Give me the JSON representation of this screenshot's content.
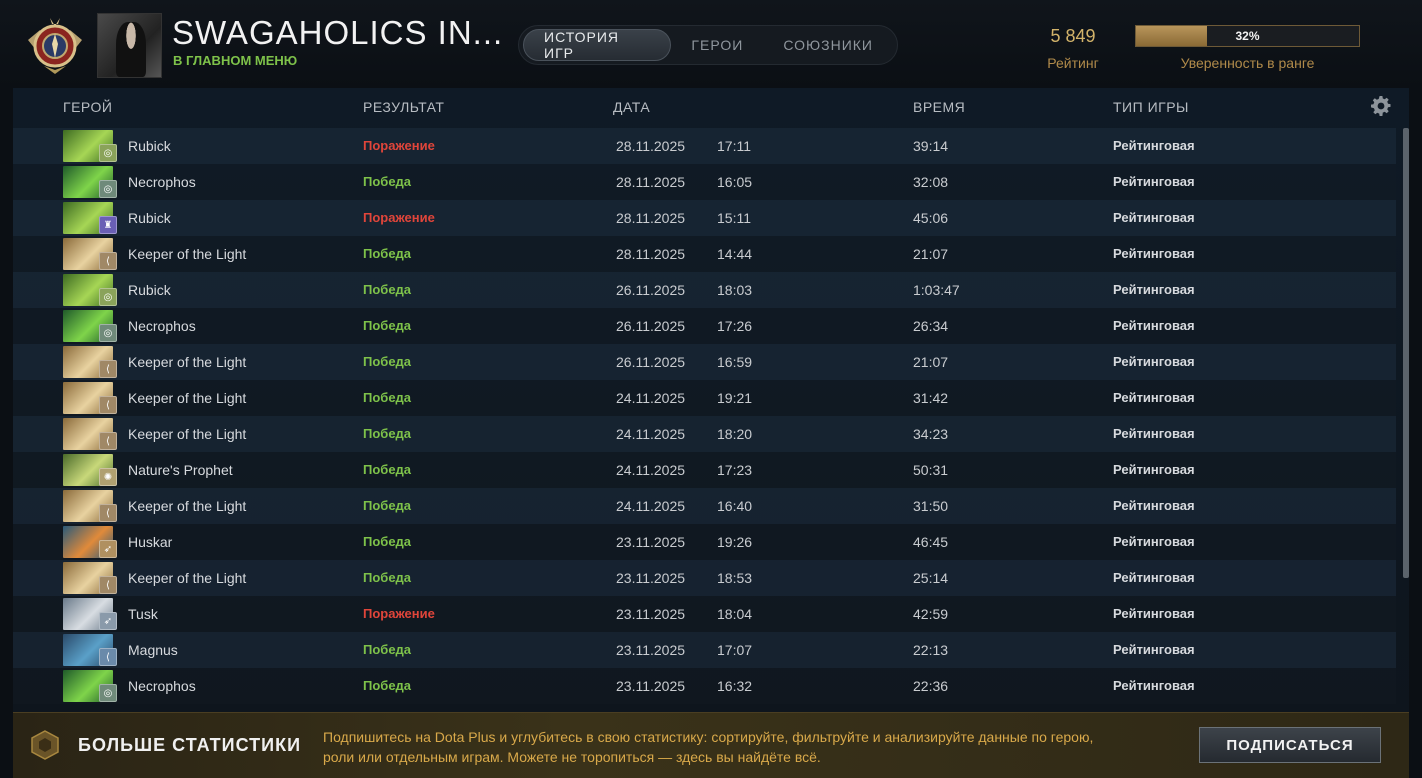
{
  "header": {
    "player_name": "SWAGAHOLICS IN...",
    "status": "В ГЛАВНОМ МЕНЮ",
    "tabs": [
      {
        "label": "ИСТОРИЯ ИГР",
        "active": true
      },
      {
        "label": "ГЕРОИ",
        "active": false
      },
      {
        "label": "СОЮЗНИКИ",
        "active": false
      }
    ],
    "rating_value": "5 849",
    "rating_label": "Рейтинг",
    "confidence_percent": 32,
    "confidence_text": "32%",
    "confidence_label": "Уверенность в ранге"
  },
  "table": {
    "columns": {
      "hero": "ГЕРОЙ",
      "result": "РЕЗУЛЬТАТ",
      "date": "ДАТА",
      "duration": "ВРЕМЯ",
      "game_type": "ТИП ИГРЫ"
    },
    "rows": [
      {
        "hero": "Rubick",
        "result": "Поражение",
        "outcome": "loss",
        "date": "28.11.2025",
        "time": "17:11",
        "duration": "39:14",
        "type": "Рейтинговая",
        "hero_colors": [
          "#3d6b22",
          "#a6d655"
        ],
        "role_color": "#8aa35a",
        "role_icon": "circle-icon"
      },
      {
        "hero": "Necrophos",
        "result": "Победа",
        "outcome": "win",
        "date": "28.11.2025",
        "time": "16:05",
        "duration": "32:08",
        "type": "Рейтинговая",
        "hero_colors": [
          "#1f5a2a",
          "#7fd44a"
        ],
        "role_color": "#6f8a7a",
        "role_icon": "circle-icon"
      },
      {
        "hero": "Rubick",
        "result": "Поражение",
        "outcome": "loss",
        "date": "28.11.2025",
        "time": "15:11",
        "duration": "45:06",
        "type": "Рейтинговая",
        "hero_colors": [
          "#3d6b22",
          "#a6d655"
        ],
        "role_color": "#6a5fb5",
        "role_icon": "chess-icon"
      },
      {
        "hero": "Keeper of the Light",
        "result": "Победа",
        "outcome": "win",
        "date": "28.11.2025",
        "time": "14:44",
        "duration": "21:07",
        "type": "Рейтинговая",
        "hero_colors": [
          "#8a6a3a",
          "#e8d2a0"
        ],
        "role_color": "#a08866",
        "role_icon": "wing-icon"
      },
      {
        "hero": "Rubick",
        "result": "Победа",
        "outcome": "win",
        "date": "26.11.2025",
        "time": "18:03",
        "duration": "1:03:47",
        "type": "Рейтинговая",
        "hero_colors": [
          "#3d6b22",
          "#a6d655"
        ],
        "role_color": "#8aa35a",
        "role_icon": "circle-icon"
      },
      {
        "hero": "Necrophos",
        "result": "Победа",
        "outcome": "win",
        "date": "26.11.2025",
        "time": "17:26",
        "duration": "26:34",
        "type": "Рейтинговая",
        "hero_colors": [
          "#1f5a2a",
          "#7fd44a"
        ],
        "role_color": "#6f8a7a",
        "role_icon": "circle-icon"
      },
      {
        "hero": "Keeper of the Light",
        "result": "Победа",
        "outcome": "win",
        "date": "26.11.2025",
        "time": "16:59",
        "duration": "21:07",
        "type": "Рейтинговая",
        "hero_colors": [
          "#8a6a3a",
          "#e8d2a0"
        ],
        "role_color": "#a08866",
        "role_icon": "wing-icon"
      },
      {
        "hero": "Keeper of the Light",
        "result": "Победа",
        "outcome": "win",
        "date": "24.11.2025",
        "time": "19:21",
        "duration": "31:42",
        "type": "Рейтинговая",
        "hero_colors": [
          "#8a6a3a",
          "#e8d2a0"
        ],
        "role_color": "#a08866",
        "role_icon": "wing-icon"
      },
      {
        "hero": "Keeper of the Light",
        "result": "Победа",
        "outcome": "win",
        "date": "24.11.2025",
        "time": "18:20",
        "duration": "34:23",
        "type": "Рейтинговая",
        "hero_colors": [
          "#8a6a3a",
          "#e8d2a0"
        ],
        "role_color": "#a08866",
        "role_icon": "wing-icon"
      },
      {
        "hero": "Nature's Prophet",
        "result": "Победа",
        "outcome": "win",
        "date": "24.11.2025",
        "time": "17:23",
        "duration": "50:31",
        "type": "Рейтинговая",
        "hero_colors": [
          "#4a6a2a",
          "#c8d87a"
        ],
        "role_color": "#b0a070",
        "role_icon": "swirl-icon"
      },
      {
        "hero": "Keeper of the Light",
        "result": "Победа",
        "outcome": "win",
        "date": "24.11.2025",
        "time": "16:40",
        "duration": "31:50",
        "type": "Рейтинговая",
        "hero_colors": [
          "#8a6a3a",
          "#e8d2a0"
        ],
        "role_color": "#a08866",
        "role_icon": "wing-icon"
      },
      {
        "hero": "Huskar",
        "result": "Победа",
        "outcome": "win",
        "date": "23.11.2025",
        "time": "19:26",
        "duration": "46:45",
        "type": "Рейтинговая",
        "hero_colors": [
          "#2a5a7a",
          "#e08a3a"
        ],
        "role_color": "#b09060",
        "role_icon": "spear-icon"
      },
      {
        "hero": "Keeper of the Light",
        "result": "Победа",
        "outcome": "win",
        "date": "23.11.2025",
        "time": "18:53",
        "duration": "25:14",
        "type": "Рейтинговая",
        "hero_colors": [
          "#8a6a3a",
          "#e8d2a0"
        ],
        "role_color": "#a08866",
        "role_icon": "wing-icon"
      },
      {
        "hero": "Tusk",
        "result": "Поражение",
        "outcome": "loss",
        "date": "23.11.2025",
        "time": "18:04",
        "duration": "42:59",
        "type": "Рейтинговая",
        "hero_colors": [
          "#6a7a8a",
          "#d8dde2"
        ],
        "role_color": "#8a9aaa",
        "role_icon": "spear-icon"
      },
      {
        "hero": "Magnus",
        "result": "Победа",
        "outcome": "win",
        "date": "23.11.2025",
        "time": "17:07",
        "duration": "22:13",
        "type": "Рейтинговая",
        "hero_colors": [
          "#2a4a6a",
          "#5aa0c8"
        ],
        "role_color": "#6a8aaa",
        "role_icon": "wing-icon"
      },
      {
        "hero": "Necrophos",
        "result": "Победа",
        "outcome": "win",
        "date": "23.11.2025",
        "time": "16:32",
        "duration": "22:36",
        "type": "Рейтинговая",
        "hero_colors": [
          "#1f5a2a",
          "#7fd44a"
        ],
        "role_color": "#6f8a7a",
        "role_icon": "circle-icon"
      }
    ]
  },
  "footer": {
    "title": "БОЛЬШЕ СТАТИСТИКИ",
    "text": "Подпишитесь на Dota Plus и углубитесь в свою статистику: сортируйте, фильтруйте и анализируйте данные по герою, роли или отдельным играм. Можете не торопиться — здесь вы найдёте всё.",
    "button": "ПОДПИСАТЬСЯ"
  },
  "colors": {
    "win": "#7ec24a",
    "loss": "#e0453a",
    "gold": "#d2b36a"
  }
}
